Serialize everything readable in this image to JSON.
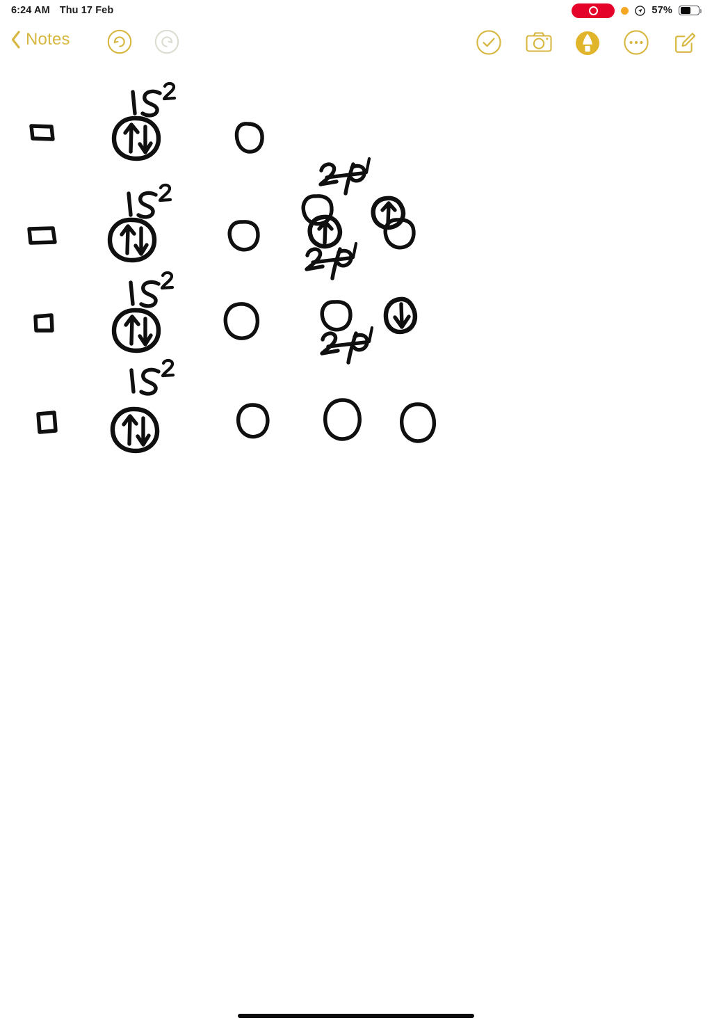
{
  "status_bar": {
    "time": "6:24 AM",
    "date": "Thu 17 Feb",
    "battery_percent": "57%",
    "battery_level": 57,
    "recording_indicator": "screen-recording-active",
    "privacy_dot": "orange",
    "location_icon": "location-active",
    "colors": {
      "recording_red": "#e4022a",
      "orange_dot": "#f5a623",
      "text": "#1c1c1e"
    }
  },
  "toolbar": {
    "back_label": "Notes",
    "back_icon": "chevron-left-icon",
    "undo_label": "Undo",
    "undo_icon": "undo-circle-icon",
    "undo_enabled": true,
    "redo_label": "Redo",
    "redo_icon": "redo-circle-icon",
    "redo_enabled": false,
    "done_label": "Done",
    "done_icon": "checkmark-circle-icon",
    "camera_label": "Insert Media",
    "camera_icon": "camera-icon",
    "markup_label": "Markup",
    "markup_icon": "markup-pen-icon",
    "markup_active": true,
    "more_label": "More",
    "more_icon": "ellipsis-circle-icon",
    "compose_label": "New Note",
    "compose_icon": "compose-square-icon",
    "colors": {
      "accent": "#d7b740",
      "disabled": "#d8d8d0"
    }
  },
  "note": {
    "title": "Handwritten orbital diagram note",
    "ink_color": "#101010",
    "background": "#ffffff",
    "rows": [
      {
        "row_index": 1,
        "element_box": "square-outline",
        "labels": [
          {
            "text": "1 s2",
            "display": "1 s²",
            "over_orbital": 1
          },
          {
            "text": "2 p1",
            "display": "2 p¹",
            "over_orbital": 3
          }
        ],
        "orbitals": [
          {
            "position": 1,
            "electrons": "up-down"
          },
          {
            "position": 2,
            "electrons": "empty"
          },
          {
            "position": 3,
            "electrons": "empty"
          },
          {
            "position": 4,
            "electrons": "up"
          }
        ]
      },
      {
        "row_index": 2,
        "element_box": "square-outline",
        "labels": [
          {
            "text": "1 s2",
            "display": "1 s²",
            "over_orbital": 1
          },
          {
            "text": "2 p1",
            "display": "2 p¹",
            "over_orbital": 3
          }
        ],
        "orbitals": [
          {
            "position": 1,
            "electrons": "up-down"
          },
          {
            "position": 2,
            "electrons": "empty"
          },
          {
            "position": 3,
            "electrons": "up"
          },
          {
            "position": 4,
            "electrons": "empty"
          }
        ]
      },
      {
        "row_index": 3,
        "element_box": "square-outline",
        "labels": [
          {
            "text": "1 s2",
            "display": "1 s²",
            "over_orbital": 1
          },
          {
            "text": "2 p1",
            "display": "2 p¹",
            "over_orbital": 3
          }
        ],
        "orbitals": [
          {
            "position": 1,
            "electrons": "up-down"
          },
          {
            "position": 2,
            "electrons": "empty"
          },
          {
            "position": 3,
            "electrons": "empty"
          },
          {
            "position": 4,
            "electrons": "down"
          }
        ]
      },
      {
        "row_index": 4,
        "element_box": "square-outline",
        "labels": [
          {
            "text": "1 s2",
            "display": "1 s²",
            "over_orbital": 1
          }
        ],
        "orbitals": [
          {
            "position": 1,
            "electrons": "up-down"
          },
          {
            "position": 2,
            "electrons": "empty"
          },
          {
            "position": 3,
            "electrons": "empty"
          },
          {
            "position": 4,
            "electrons": "empty"
          }
        ]
      }
    ]
  },
  "home_indicator": {
    "label": "Home Indicator"
  }
}
